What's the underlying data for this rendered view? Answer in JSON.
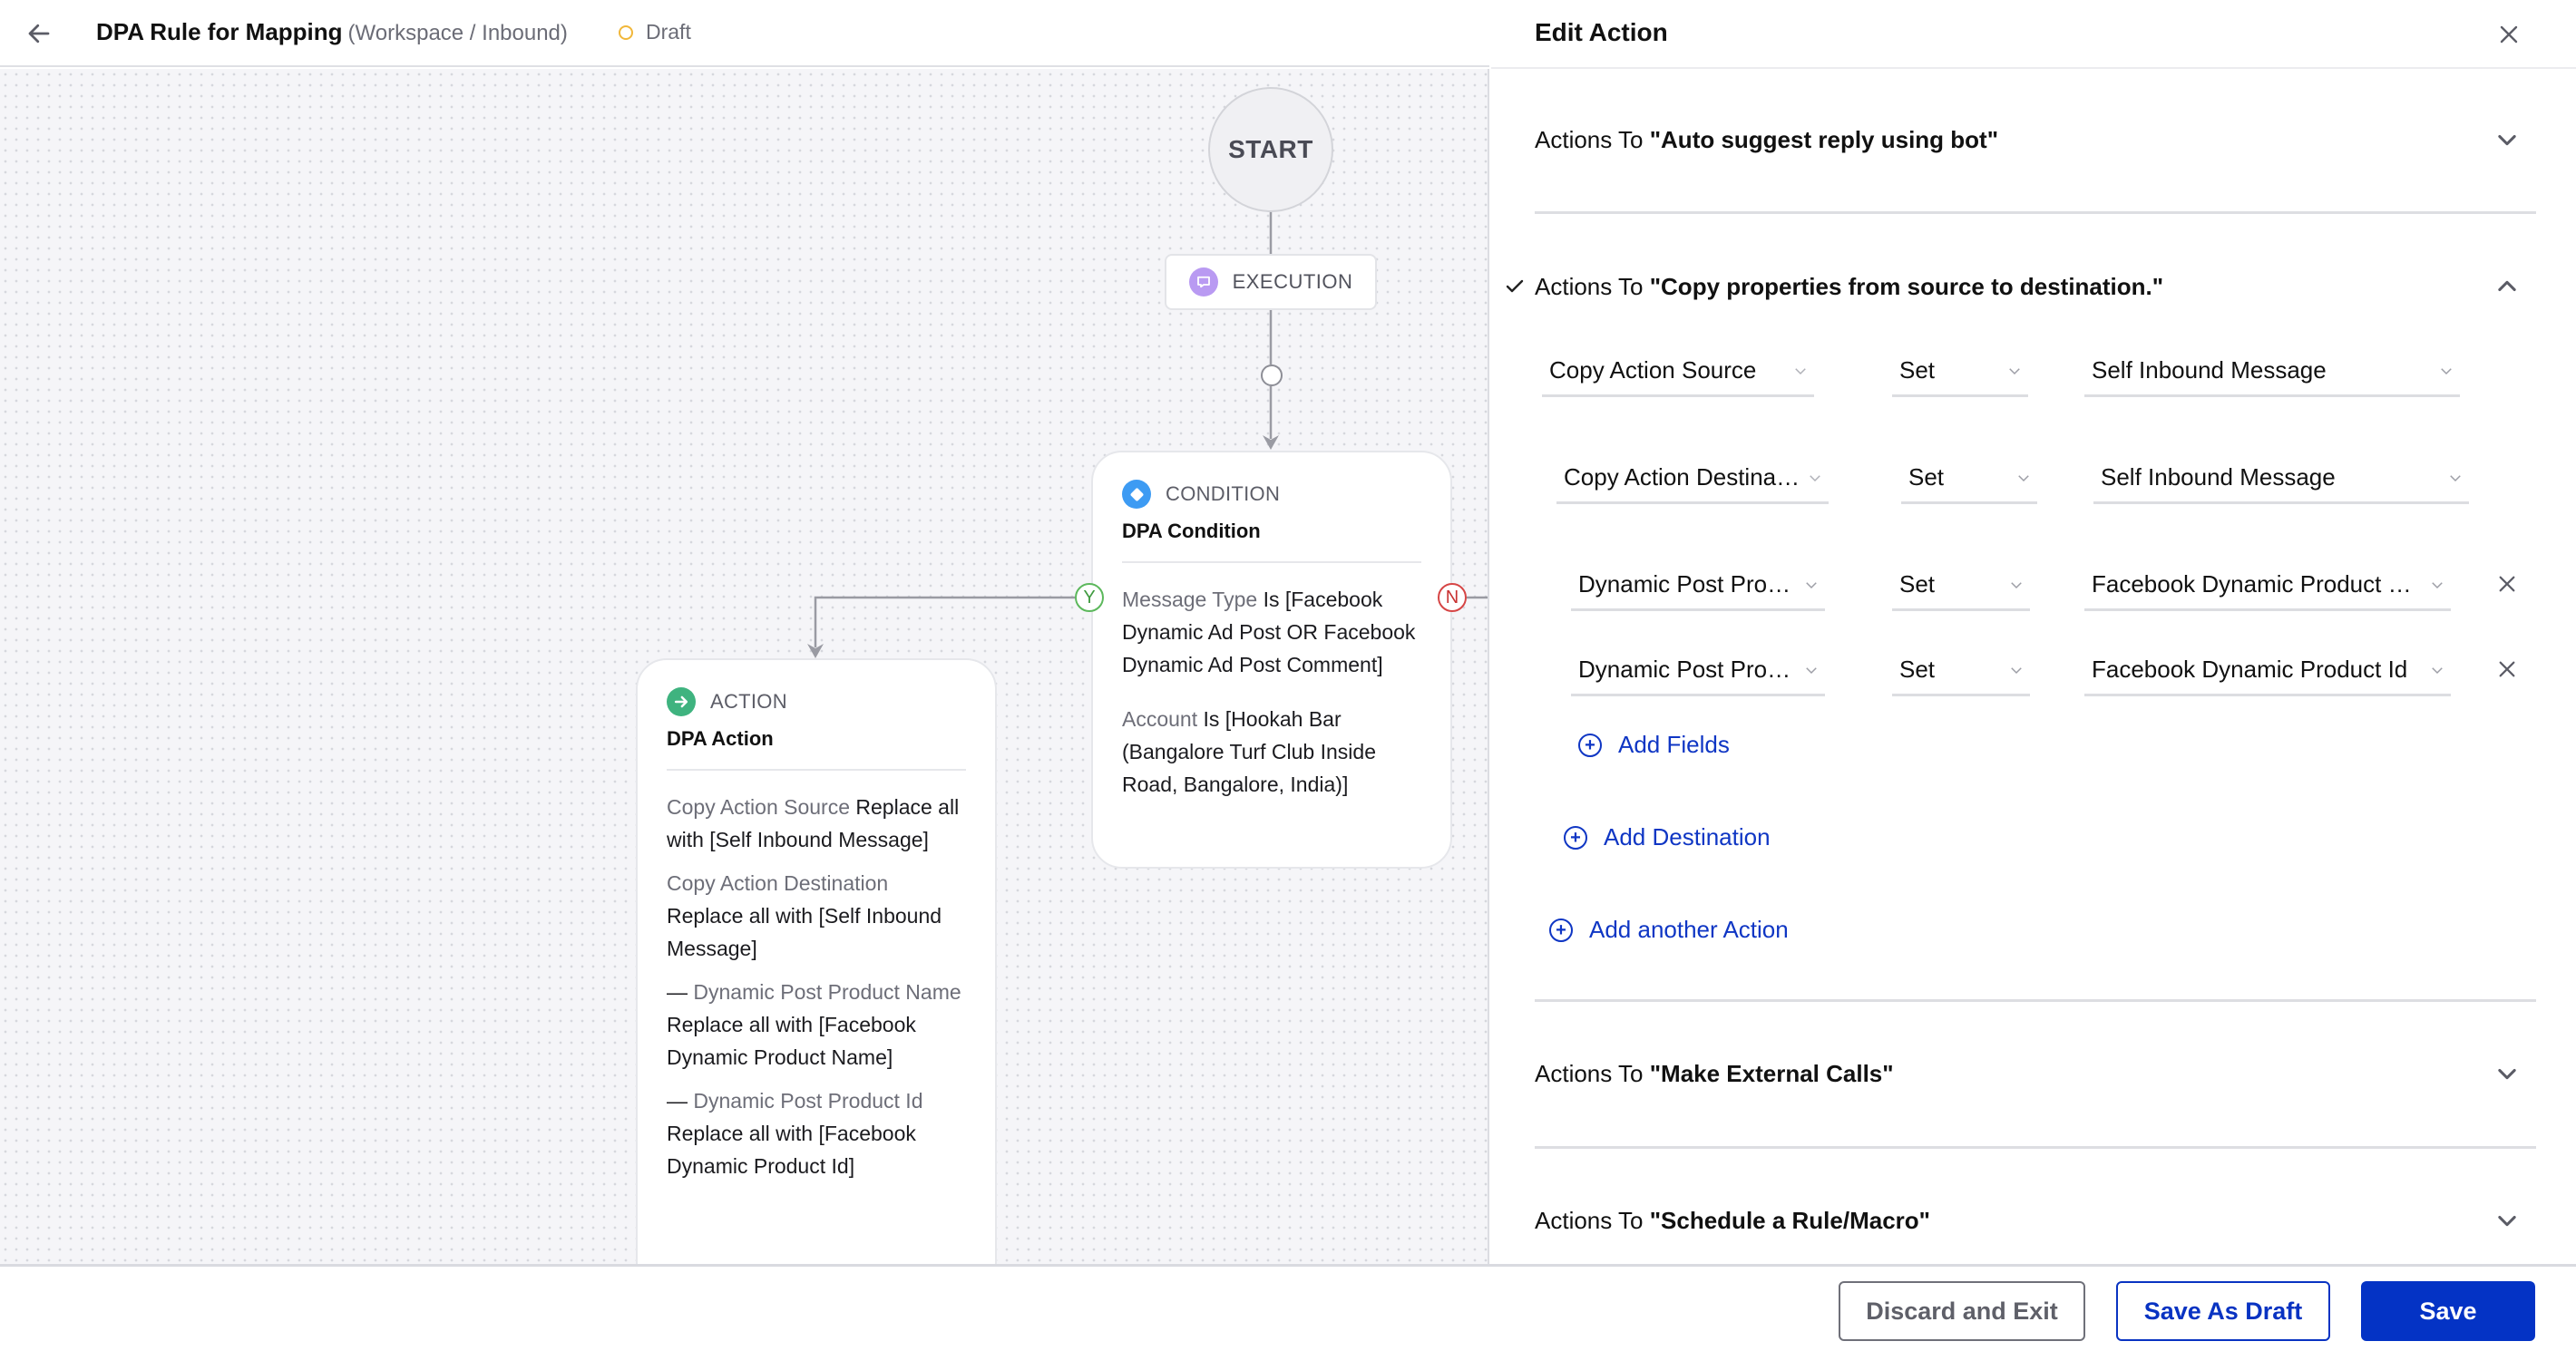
{
  "header": {
    "back_icon": "arrow-left-icon",
    "title": "DPA Rule for Mapping",
    "subtitle": "(Workspace / Inbound)",
    "status": "Draft",
    "status_color": "#f1b73a"
  },
  "canvas": {
    "start_label": "START",
    "execution_label": "EXECUTION",
    "execution_icon": "chat-bubble-icon",
    "condition": {
      "type_label": "CONDITION",
      "name": "DPA Condition",
      "rules": [
        {
          "field": "Message Type",
          "text": "Is [Facebook Dynamic Ad Post OR Facebook Dynamic Ad Post Comment]"
        },
        {
          "field": "Account",
          "text": "Is [Hookah Bar (Bangalore Turf Club Inside Road, Bangalore, India)]"
        }
      ],
      "yes_label": "Y",
      "no_label": "N"
    },
    "action": {
      "type_label": "ACTION",
      "name": "DPA Action",
      "items": [
        {
          "prefix": "",
          "field": "Copy Action Source",
          "text": "Replace all with [Self Inbound Message]"
        },
        {
          "prefix": "",
          "field": "Copy Action Destination",
          "text": "Replace all with [Self Inbound Message]"
        },
        {
          "prefix": "—",
          "field": "Dynamic Post Product Name",
          "text": "Replace all with [Facebook Dynamic Product Name]"
        },
        {
          "prefix": "—",
          "field": "Dynamic Post Product Id",
          "text": "Replace all with [Facebook Dynamic Product Id]"
        }
      ]
    }
  },
  "panel": {
    "title": "Edit Action",
    "close_icon": "close-icon",
    "accordions": [
      {
        "prefix": "Actions To ",
        "name": "\"Auto suggest reply using bot\"",
        "expanded": false
      },
      {
        "prefix": "Actions To ",
        "name": "\"Copy properties from source to destination.\"",
        "expanded": true,
        "completed": true
      },
      {
        "prefix": "Actions To ",
        "name": "\"Make External Calls\"",
        "expanded": false
      },
      {
        "prefix": "Actions To ",
        "name": "\"Schedule a Rule/Macro\"",
        "expanded": false
      }
    ],
    "copy_rows": [
      {
        "field": "Copy Action Source",
        "op": "Set",
        "value": "Self Inbound Message",
        "removable": false
      },
      {
        "field": "Copy Action Destination",
        "op": "Set",
        "value": "Self Inbound Message",
        "removable": false
      },
      {
        "field": "Dynamic Post Product Name",
        "op": "Set",
        "value": "Facebook Dynamic Product Name",
        "removable": true
      },
      {
        "field": "Dynamic Post Product Id",
        "op": "Set",
        "value": "Facebook Dynamic Product Id",
        "removable": true
      }
    ],
    "add_fields_label": "Add Fields",
    "add_destination_label": "Add Destination",
    "add_action_label": "Add another Action",
    "link_color": "#0f36c4"
  },
  "footer": {
    "discard_label": "Discard and Exit",
    "draft_label": "Save As Draft",
    "save_label": "Save",
    "primary_color": "#0433c5"
  }
}
